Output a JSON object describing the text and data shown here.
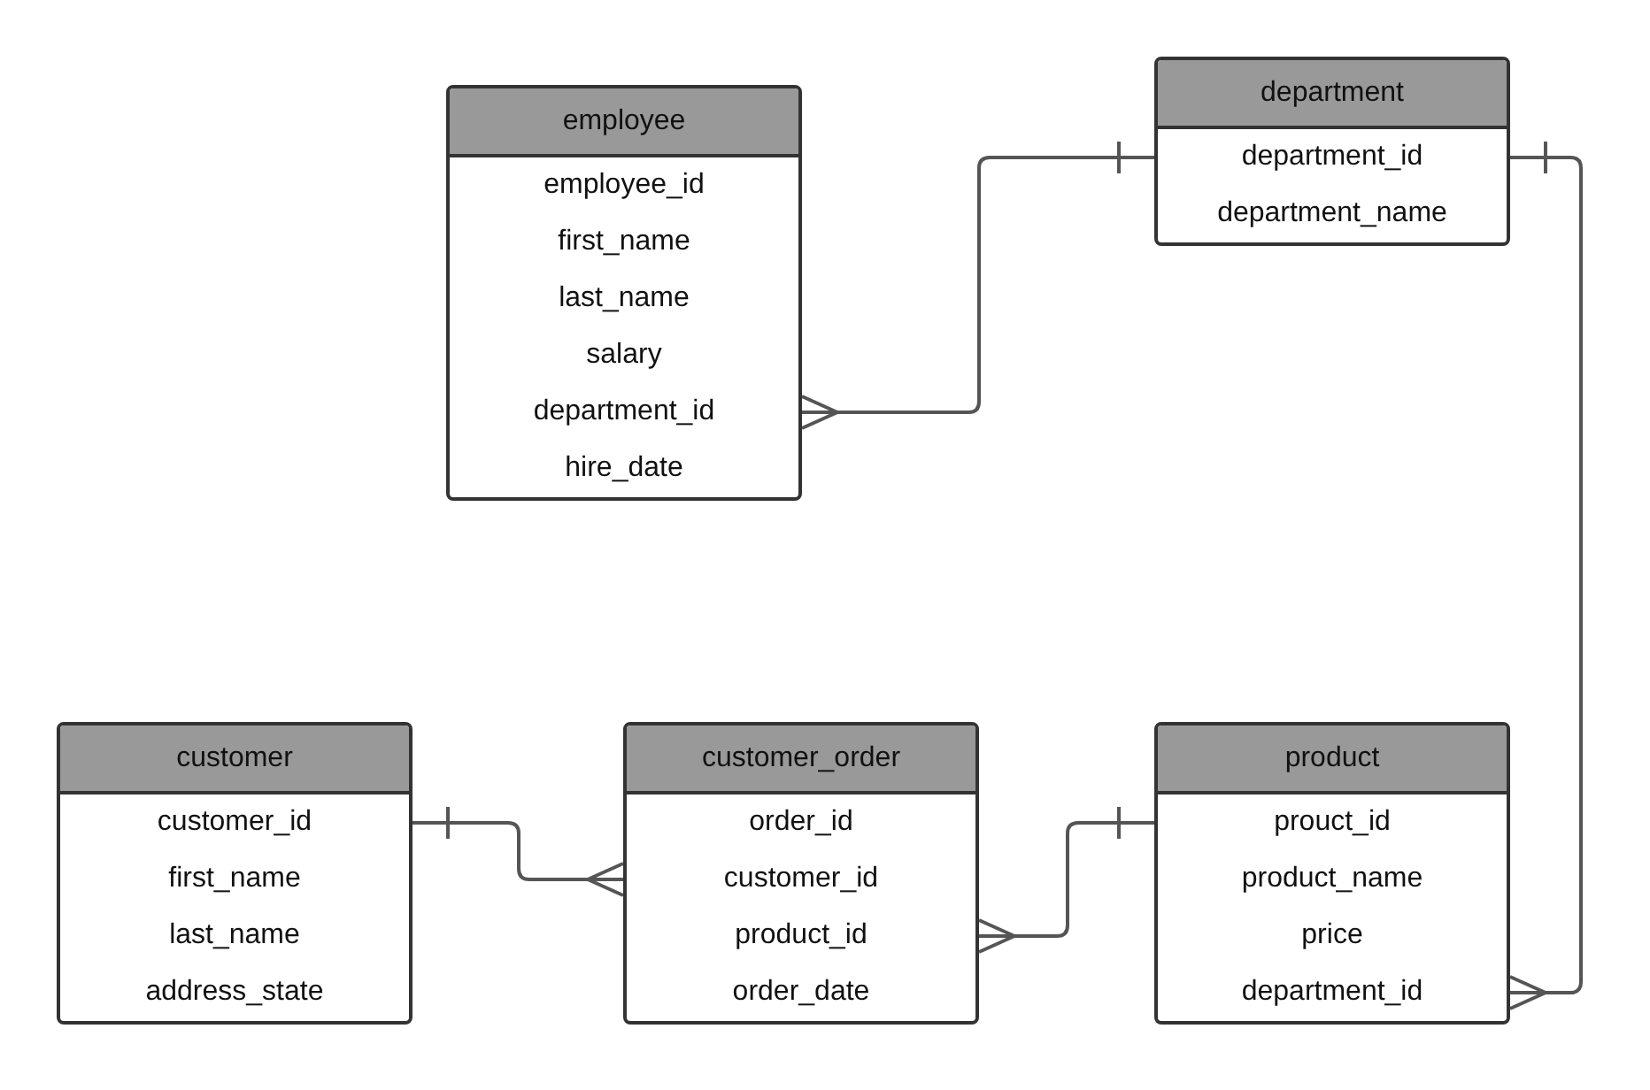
{
  "entities": [
    {
      "name": "employee",
      "attributes": [
        "employee_id",
        "first_name",
        "last_name",
        "salary",
        "department_id",
        "hire_date"
      ]
    },
    {
      "name": "department",
      "attributes": [
        "department_id",
        "department_name"
      ]
    },
    {
      "name": "customer",
      "attributes": [
        "customer_id",
        "first_name",
        "last_name",
        "address_state"
      ]
    },
    {
      "name": "customer_order",
      "attributes": [
        "order_id",
        "customer_id",
        "product_id",
        "order_date"
      ]
    },
    {
      "name": "product",
      "attributes": [
        "prouct_id",
        "product_name",
        "price",
        "department_id"
      ]
    }
  ]
}
